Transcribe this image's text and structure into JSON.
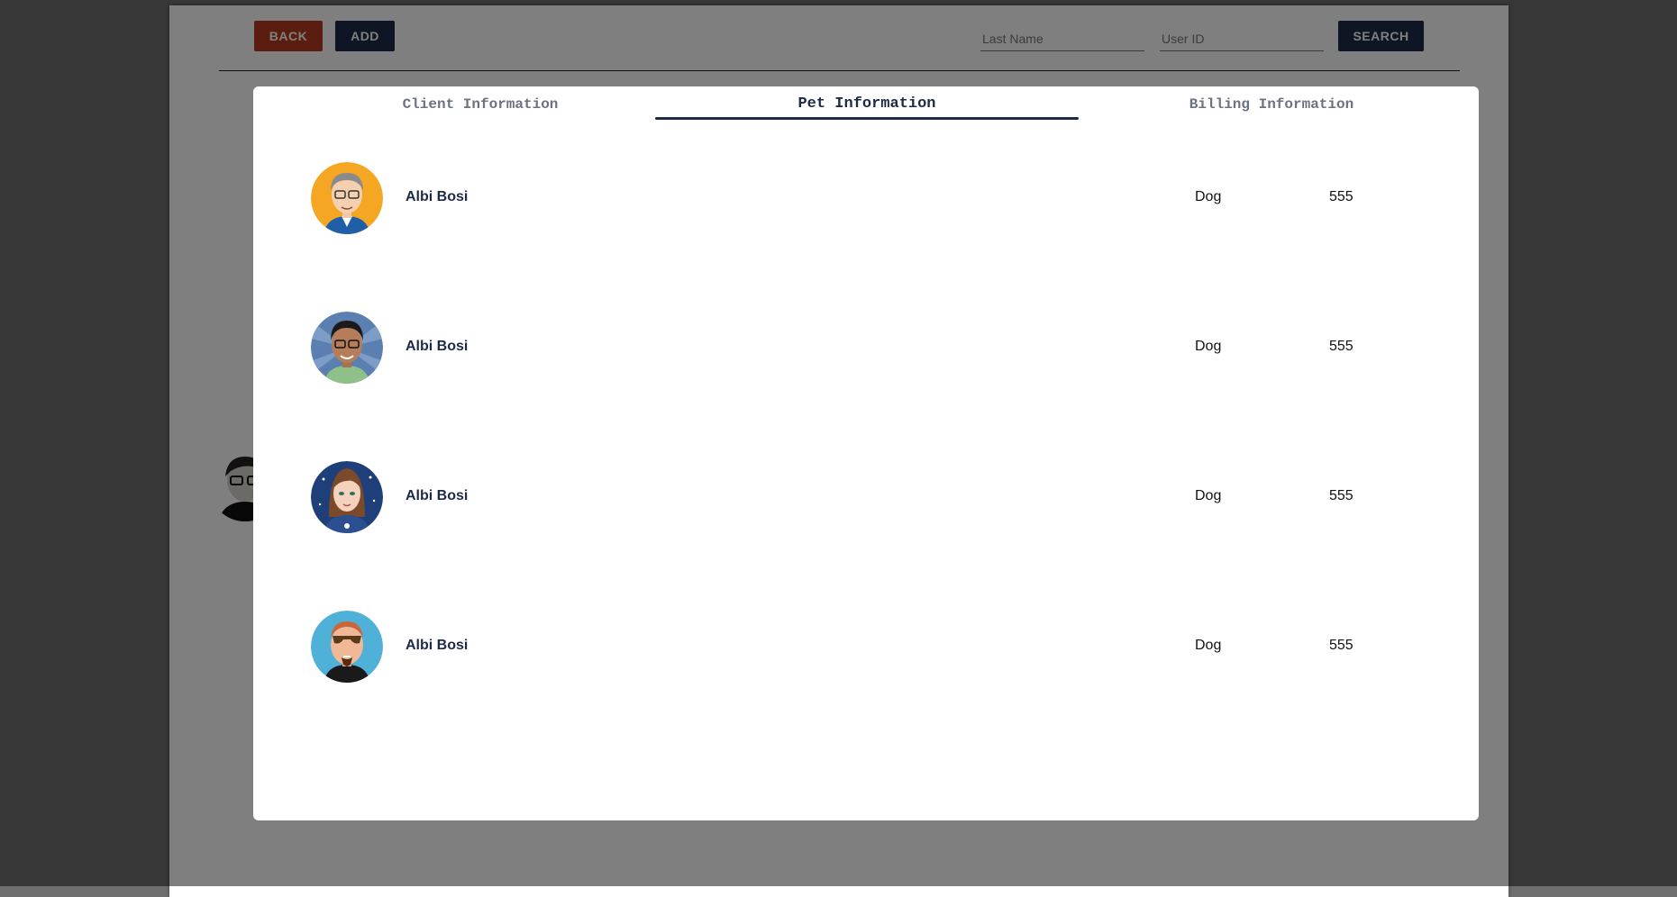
{
  "toolbar": {
    "back_label": "BACK",
    "add_label": "ADD",
    "search_label": "SEARCH",
    "last_name_placeholder": "Last Name",
    "user_id_placeholder": "User ID"
  },
  "modal": {
    "tabs": [
      {
        "label": "Client Information",
        "active": false
      },
      {
        "label": "Pet Information",
        "active": true
      },
      {
        "label": "Billing Information",
        "active": false
      }
    ],
    "pets": [
      {
        "name": "Albi Bosi",
        "type": "Dog",
        "phone": "555",
        "avatar": "man-glasses-avatar-orange"
      },
      {
        "name": "Albi Bosi",
        "type": "Dog",
        "phone": "555",
        "avatar": "man-glasses-avatar-blue"
      },
      {
        "name": "Albi Bosi",
        "type": "Dog",
        "phone": "555",
        "avatar": "woman-avatar-navy"
      },
      {
        "name": "Albi Bosi",
        "type": "Dog",
        "phone": "555",
        "avatar": "man-sunglasses-avatar-sky"
      }
    ]
  },
  "colors": {
    "primary": "#1d2a48",
    "danger": "#b53a20",
    "overlay": "rgba(0,0,0,0.5)"
  }
}
